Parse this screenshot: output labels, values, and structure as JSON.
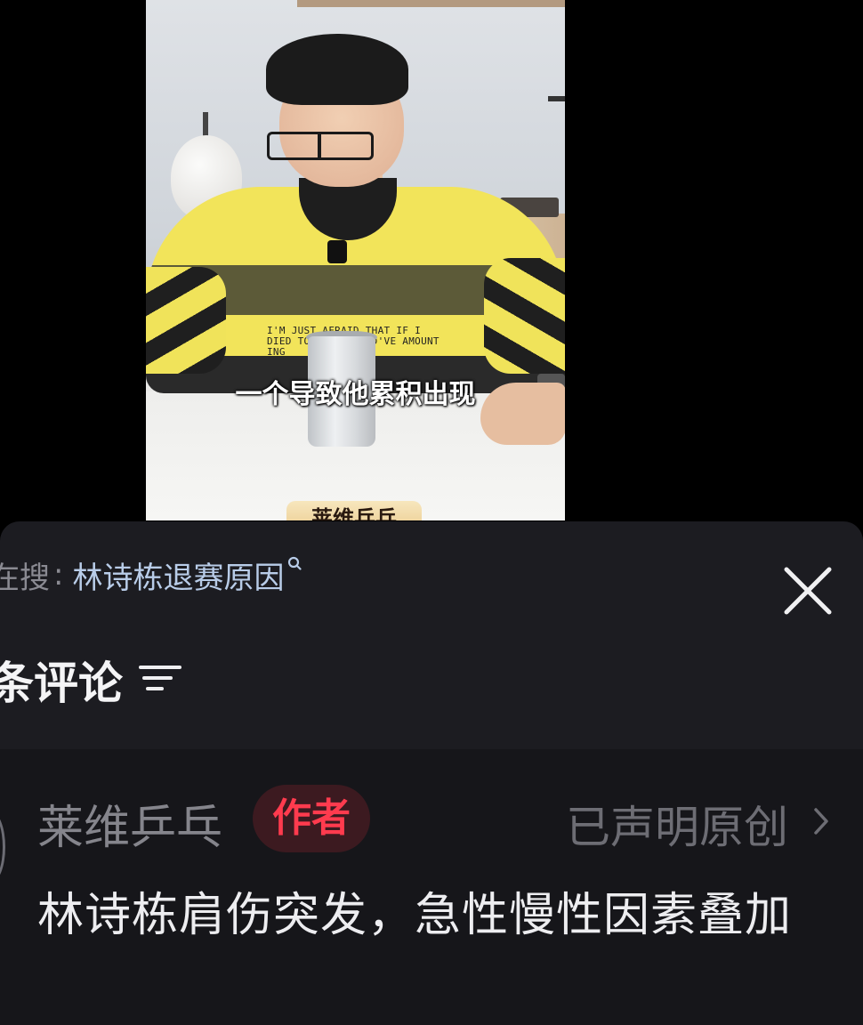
{
  "video": {
    "subtitle": "一个导致他累积出现",
    "shirt_text": "I'M JUST AFRAID THAT IF I DIED TODAY,T WOULD'VE AMOUNT ING",
    "brand_tag": "莱维乒乓"
  },
  "comment_panel": {
    "search": {
      "prefix": "在搜",
      "colon": ":",
      "term": "林诗栋退赛原因"
    },
    "title": "条评论",
    "comments": [
      {
        "author": "莱维乒乓",
        "badge": "作者",
        "original_label": "已声明原创",
        "text": "林诗栋肩伤突发，急性慢性因素叠加"
      }
    ]
  },
  "colors": {
    "panel_bg": "#1c1c21",
    "comment_bg": "#16161a",
    "search_term": "#b8cce8",
    "badge_text": "#ff3b4e",
    "badge_bg": "#3c1a20"
  },
  "icons": {
    "search": "search-icon",
    "close": "close-icon",
    "filter": "filter-icon",
    "chevron": "chevron-right-icon"
  }
}
